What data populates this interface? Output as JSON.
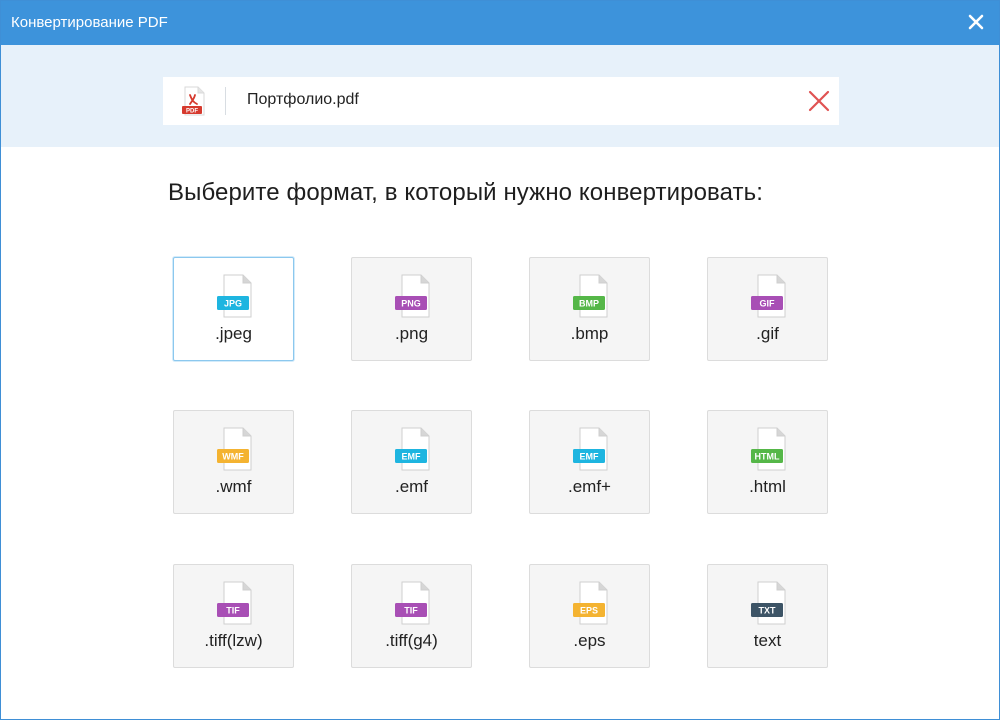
{
  "window": {
    "title": "Конвертирование PDF"
  },
  "file": {
    "name": "Портфолио.pdf",
    "icon_label": "PDF"
  },
  "heading": "Выберите формат, в который нужно конвертировать:",
  "colors": {
    "titlebar": "#3d93db",
    "filebar_area": "#e7f1fa",
    "remove_x": "#e05252",
    "selected_border": "#8cc8ee"
  },
  "formats": [
    {
      "label": ".jpeg",
      "tag": "JPG",
      "color": "#1eb5e0",
      "selected": true,
      "icon": "jpg-file-icon"
    },
    {
      "label": ".png",
      "tag": "PNG",
      "color": "#a84fb5",
      "selected": false,
      "icon": "png-file-icon"
    },
    {
      "label": ".bmp",
      "tag": "BMP",
      "color": "#55b748",
      "selected": false,
      "icon": "bmp-file-icon"
    },
    {
      "label": ".gif",
      "tag": "GIF",
      "color": "#a84fb5",
      "selected": false,
      "icon": "gif-file-icon"
    },
    {
      "label": ".wmf",
      "tag": "WMF",
      "color": "#f4b331",
      "selected": false,
      "icon": "wmf-file-icon"
    },
    {
      "label": ".emf",
      "tag": "EMF",
      "color": "#1eb5e0",
      "selected": false,
      "icon": "emf-file-icon"
    },
    {
      "label": ".emf+",
      "tag": "EMF",
      "color": "#1eb5e0",
      "selected": false,
      "icon": "emf-plus-file-icon"
    },
    {
      "label": ".html",
      "tag": "HTML",
      "color": "#55b748",
      "selected": false,
      "icon": "html-file-icon"
    },
    {
      "label": ".tiff(lzw)",
      "tag": "TIF",
      "color": "#a84fb5",
      "selected": false,
      "icon": "tif-file-icon"
    },
    {
      "label": ".tiff(g4)",
      "tag": "TIF",
      "color": "#a84fb5",
      "selected": false,
      "icon": "tif-file-icon"
    },
    {
      "label": ".eps",
      "tag": "EPS",
      "color": "#f4b331",
      "selected": false,
      "icon": "eps-file-icon"
    },
    {
      "label": "text",
      "tag": "TXT",
      "color": "#3d5466",
      "selected": false,
      "icon": "txt-file-icon"
    }
  ]
}
